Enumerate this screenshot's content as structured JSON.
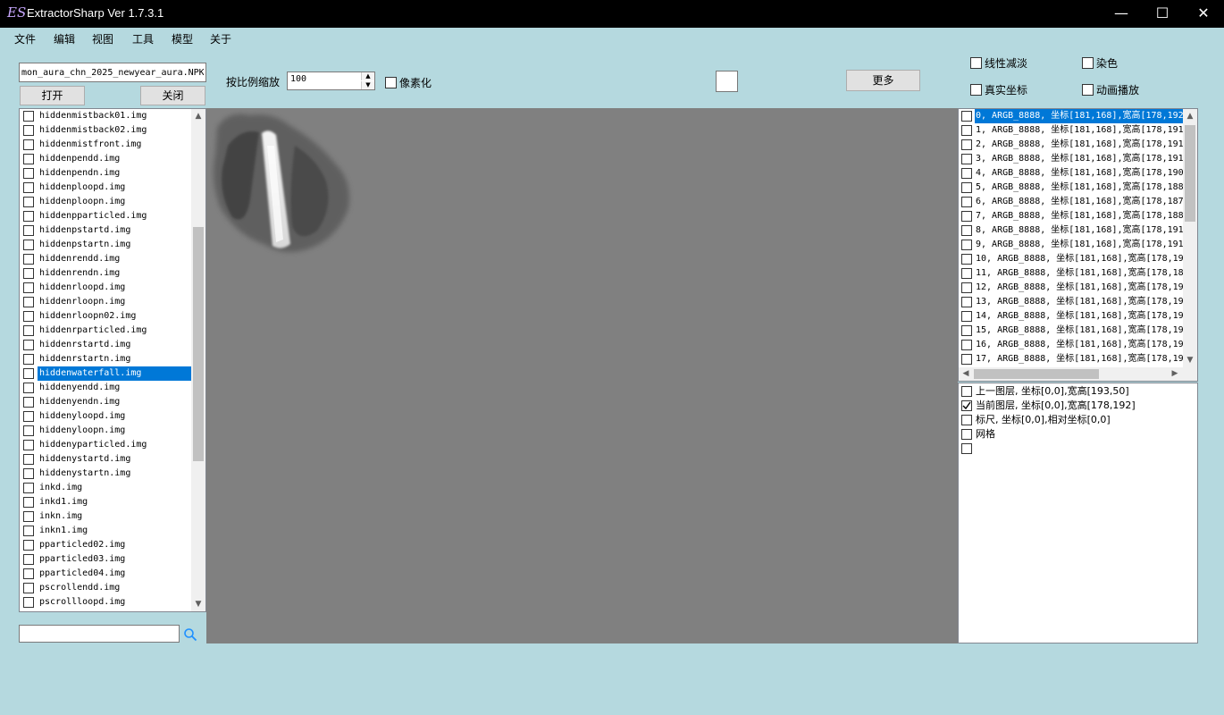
{
  "window": {
    "logo": "ES",
    "title": "ExtractorSharp Ver 1.7.3.1",
    "minimize_glyph": "—",
    "maximize_glyph": "☐",
    "close_glyph": "✕"
  },
  "menu": [
    "文件",
    "编辑",
    "视图",
    "工具",
    "模型",
    "关于"
  ],
  "toolbar": {
    "file_path": "mon_aura_chn_2025_newyear_aura.NPK",
    "open_label": "打开",
    "close_label": "关闭",
    "scale_label": "按比例缩放",
    "scale_value": "100",
    "pixelate_label": "像素化",
    "more_label": "更多",
    "linear_fade_label": "线性减淡",
    "dye_label": "染色",
    "real_coords_label": "真实坐标",
    "animate_label": "动画播放"
  },
  "files": [
    {
      "name": "hiddenmistback01.img",
      "selected": false
    },
    {
      "name": "hiddenmistback02.img",
      "selected": false
    },
    {
      "name": "hiddenmistfront.img",
      "selected": false
    },
    {
      "name": "hiddenpendd.img",
      "selected": false
    },
    {
      "name": "hiddenpendn.img",
      "selected": false
    },
    {
      "name": "hiddenploopd.img",
      "selected": false
    },
    {
      "name": "hiddenploopn.img",
      "selected": false
    },
    {
      "name": "hiddenpparticled.img",
      "selected": false
    },
    {
      "name": "hiddenpstartd.img",
      "selected": false
    },
    {
      "name": "hiddenpstartn.img",
      "selected": false
    },
    {
      "name": "hiddenrendd.img",
      "selected": false
    },
    {
      "name": "hiddenrendn.img",
      "selected": false
    },
    {
      "name": "hiddenrloopd.img",
      "selected": false
    },
    {
      "name": "hiddenrloopn.img",
      "selected": false
    },
    {
      "name": "hiddenrloopn02.img",
      "selected": false
    },
    {
      "name": "hiddenrparticled.img",
      "selected": false
    },
    {
      "name": "hiddenrstartd.img",
      "selected": false
    },
    {
      "name": "hiddenrstartn.img",
      "selected": false
    },
    {
      "name": "hiddenwaterfall.img",
      "selected": true
    },
    {
      "name": "hiddenyendd.img",
      "selected": false
    },
    {
      "name": "hiddenyendn.img",
      "selected": false
    },
    {
      "name": "hiddenyloopd.img",
      "selected": false
    },
    {
      "name": "hiddenyloopn.img",
      "selected": false
    },
    {
      "name": "hiddenyparticled.img",
      "selected": false
    },
    {
      "name": "hiddenystartd.img",
      "selected": false
    },
    {
      "name": "hiddenystartn.img",
      "selected": false
    },
    {
      "name": "inkd.img",
      "selected": false
    },
    {
      "name": "inkd1.img",
      "selected": false
    },
    {
      "name": "inkn.img",
      "selected": false
    },
    {
      "name": "inkn1.img",
      "selected": false
    },
    {
      "name": "pparticled02.img",
      "selected": false
    },
    {
      "name": "pparticled03.img",
      "selected": false
    },
    {
      "name": "pparticled04.img",
      "selected": false
    },
    {
      "name": "pscrollendd.img",
      "selected": false
    },
    {
      "name": "pscrollloopd.img",
      "selected": false
    }
  ],
  "search": {
    "value": ""
  },
  "frames": [
    {
      "label": "0, ARGB_8888, 坐标[181,168],宽高[178,192",
      "selected": true
    },
    {
      "label": "1, ARGB_8888, 坐标[181,168],宽高[178,191",
      "selected": false
    },
    {
      "label": "2, ARGB_8888, 坐标[181,168],宽高[178,191",
      "selected": false
    },
    {
      "label": "3, ARGB_8888, 坐标[181,168],宽高[178,191",
      "selected": false
    },
    {
      "label": "4, ARGB_8888, 坐标[181,168],宽高[178,190",
      "selected": false
    },
    {
      "label": "5, ARGB_8888, 坐标[181,168],宽高[178,188",
      "selected": false
    },
    {
      "label": "6, ARGB_8888, 坐标[181,168],宽高[178,187",
      "selected": false
    },
    {
      "label": "7, ARGB_8888, 坐标[181,168],宽高[178,188",
      "selected": false
    },
    {
      "label": "8, ARGB_8888, 坐标[181,168],宽高[178,191",
      "selected": false
    },
    {
      "label": "9, ARGB_8888, 坐标[181,168],宽高[178,191",
      "selected": false
    },
    {
      "label": "10, ARGB_8888, 坐标[181,168],宽高[178,19",
      "selected": false
    },
    {
      "label": "11, ARGB_8888, 坐标[181,168],宽高[178,18",
      "selected": false
    },
    {
      "label": "12, ARGB_8888, 坐标[181,168],宽高[178,19",
      "selected": false
    },
    {
      "label": "13, ARGB_8888, 坐标[181,168],宽高[178,19",
      "selected": false
    },
    {
      "label": "14, ARGB_8888, 坐标[181,168],宽高[178,19",
      "selected": false
    },
    {
      "label": "15, ARGB_8888, 坐标[181,168],宽高[178,19",
      "selected": false
    },
    {
      "label": "16, ARGB_8888, 坐标[181,168],宽高[178,19",
      "selected": false
    },
    {
      "label": "17, ARGB_8888, 坐标[181,168],宽高[178,19",
      "selected": false
    }
  ],
  "layers": [
    {
      "label": "上一图层, 坐标[0,0],宽高[193,50]",
      "checked": false
    },
    {
      "label": "当前图层, 坐标[0,0],宽高[178,192]",
      "checked": true
    },
    {
      "label": "标尺, 坐标[0,0],相对坐标[0,0]",
      "checked": false
    },
    {
      "label": "网格",
      "checked": false
    },
    {
      "label": "",
      "checked": false
    }
  ],
  "colors": {
    "background": "#b5d9df",
    "selection": "#0078d7",
    "canvas": "#808080"
  }
}
